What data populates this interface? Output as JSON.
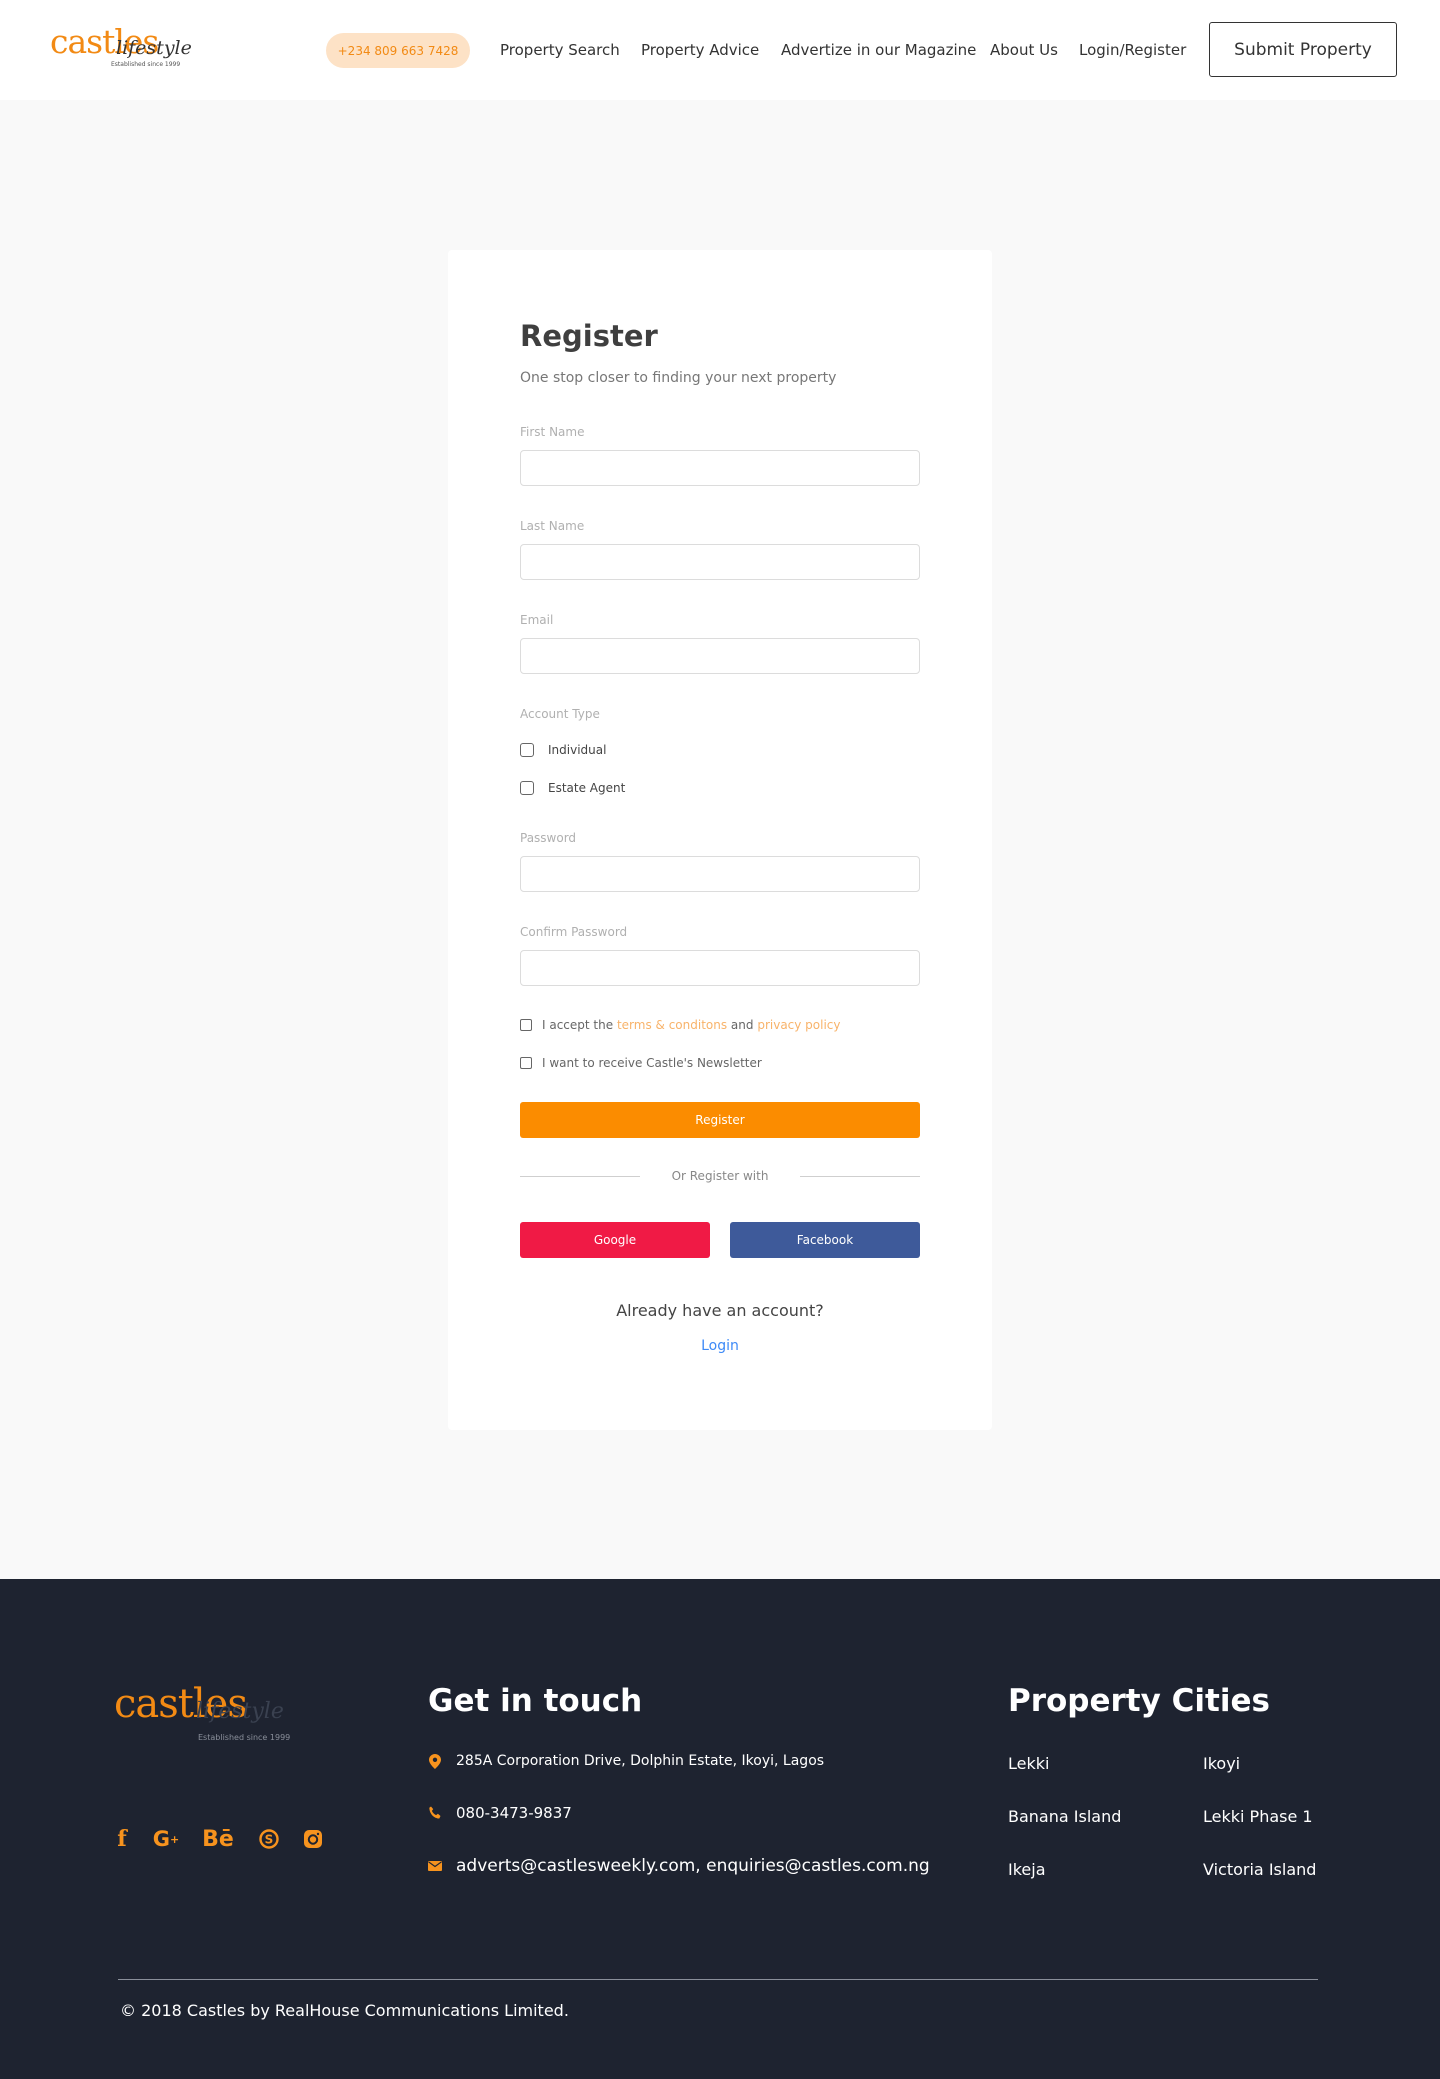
{
  "header": {
    "logo": {
      "brand": "castles",
      "script": "lifestyle",
      "since": "Established since 1999"
    },
    "phone": "+234 809 663 7428",
    "nav": [
      "Property Search",
      "Property Advice",
      "Advertize in our Magazine",
      "About Us",
      "Login/Register"
    ],
    "submit_label": "Submit Property"
  },
  "form": {
    "title": "Register",
    "subtitle": "One stop closer to finding your next property",
    "first_name_label": "First Name",
    "first_name_value": "",
    "last_name_label": "Last Name",
    "last_name_value": "",
    "email_label": "Email",
    "email_value": "",
    "account_type_label": "Account Type",
    "account_types": [
      {
        "label": "Individual",
        "checked": false
      },
      {
        "label": "Estate Agent",
        "checked": false
      }
    ],
    "password_label": "Password",
    "confirm_password_label": "Confirm Password",
    "accept_prefix": "I accept the",
    "terms_link": "terms & conditons",
    "and_text": "and",
    "privacy_link": "privacy policy",
    "newsletter_label": "I want to receive Castle's Newsletter",
    "register_label": "Register",
    "or_register_with": "Or Register with",
    "google_label": "Google",
    "facebook_label": "Facebook",
    "already_text": "Already have an account?",
    "login_label": "Login"
  },
  "footer": {
    "logo": {
      "brand": "castles",
      "script": "lifestyle",
      "since": "Established since 1999"
    },
    "social_icons": [
      "facebook-icon",
      "google-plus-icon",
      "behance-icon",
      "skype-icon",
      "instagram-icon"
    ],
    "get_in_touch_title": "Get in touch",
    "address": "285A Corporation Drive, Dolphin Estate, Ikoyi, Lagos",
    "phone": "080-3473-9837",
    "emails": "adverts@castlesweekly.com, enquiries@castles.com.ng",
    "cities_title": "Property Cities",
    "cities": [
      "Lekki",
      "Ikoyi",
      "Banana Island",
      "Lekki Phase 1",
      "Ikeja",
      "Victoria Island"
    ],
    "copyright": "© 2018 Castles by RealHouse Communications Limited."
  },
  "colors": {
    "accent": "#fb8c00",
    "google": "#f01a45",
    "facebook": "#3e5a9a",
    "footer_bg": "#1e2330",
    "link_blue": "#3d8af7"
  }
}
